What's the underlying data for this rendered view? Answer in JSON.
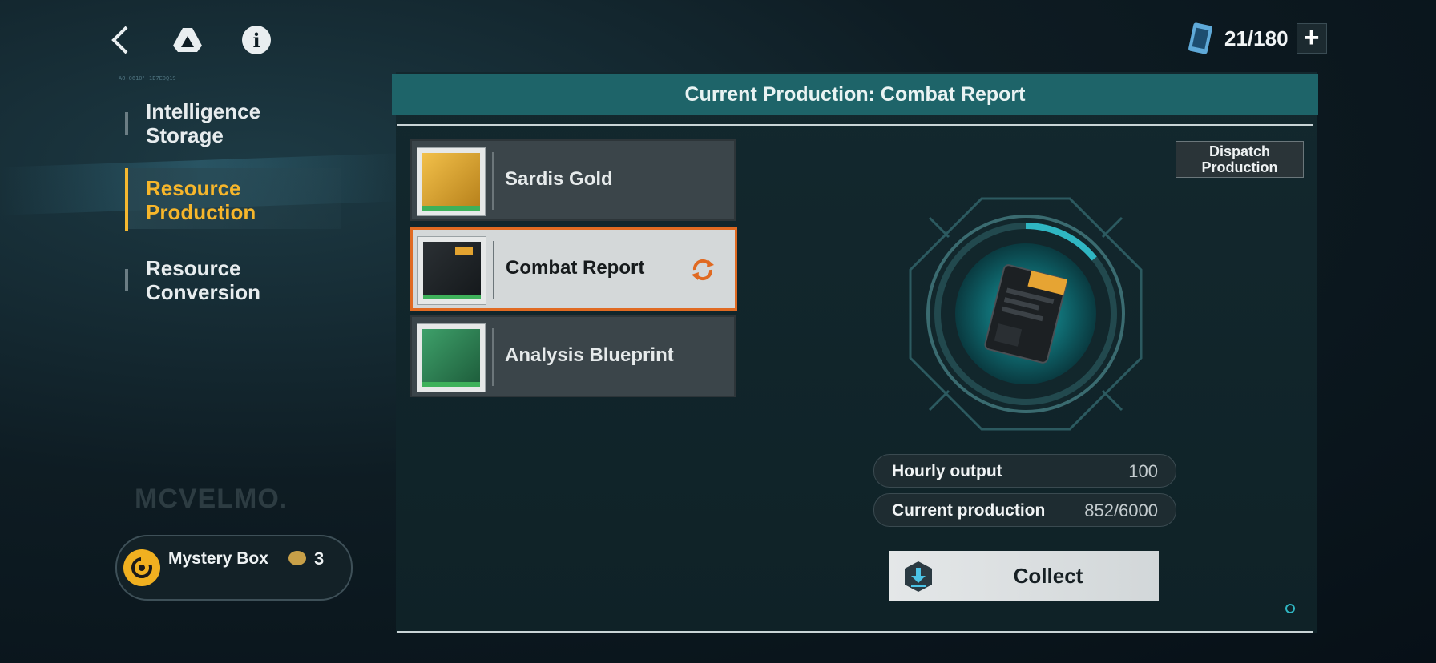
{
  "topbar": {
    "back_icon": "chevron-left-icon",
    "drive_icon": "triangle-logo-icon",
    "info_icon": "info-icon",
    "stamina_icon": "battery-cell-icon",
    "stamina_count": "21/180",
    "add_label": "+"
  },
  "sidebar": {
    "items": [
      {
        "label": "Intelligence Storage",
        "active": false
      },
      {
        "label": "Resource Production",
        "active": true
      },
      {
        "label": "Resource Conversion",
        "active": false
      }
    ],
    "watermark": "MCVELMO.",
    "tiny_code": "AO-0610' 1E7E0Q19"
  },
  "mystery_box": {
    "label": "Mystery Box",
    "count": "3"
  },
  "panel": {
    "title": "Current Production: Combat Report",
    "dispatch_label": "Dispatch Production",
    "items": [
      {
        "label": "Sardis Gold",
        "selected": false,
        "thumb_color": "#d9a52a"
      },
      {
        "label": "Combat Report",
        "selected": true,
        "thumb_color": "#1f2428"
      },
      {
        "label": "Analysis Blueprint",
        "selected": false,
        "thumb_color": "#2f8a5a"
      }
    ],
    "progress_ring_fraction": 0.142,
    "stats": {
      "hourly_label": "Hourly output",
      "hourly_value": "100",
      "current_label": "Current production",
      "current_value": "852/6000"
    },
    "collect_label": "Collect"
  },
  "colors": {
    "accent": "#f6b62b",
    "selection": "#e06a22",
    "header": "#1e6469",
    "ring": "#2fb6c2"
  }
}
